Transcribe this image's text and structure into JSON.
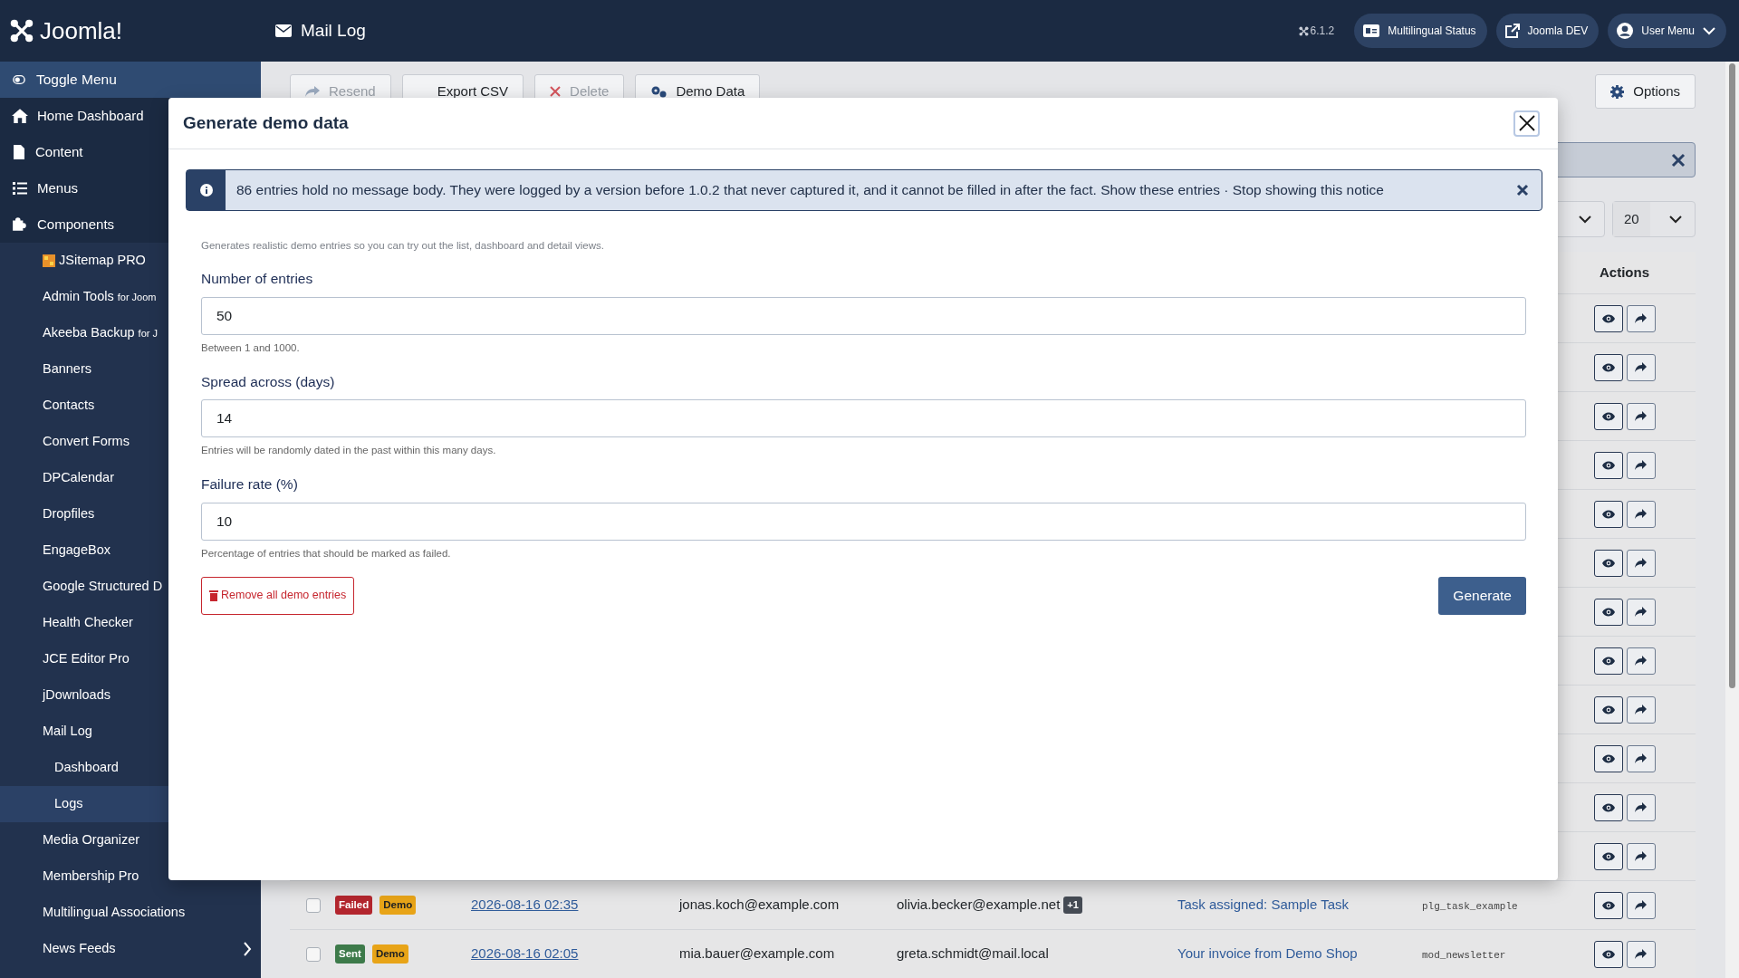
{
  "header": {
    "logo": "Joomla!",
    "title": "Mail Log",
    "version": "6.1.2",
    "buttons": [
      "Multilingual Status",
      "Joomla DEV",
      "User Menu"
    ]
  },
  "sidebar": {
    "toggle": "Toggle Menu",
    "items": [
      {
        "label": "Home Dashboard",
        "selected": false
      },
      {
        "label": "Content",
        "selected": false
      },
      {
        "label": "Menus",
        "selected": false
      },
      {
        "label": "Components",
        "selected": false,
        "children": [
          {
            "label": "JSitemap PRO",
            "selected": false
          },
          {
            "label": "Admin Tools",
            "suffix": "for Joom",
            "selected": false
          },
          {
            "label": "Akeeba Backup",
            "suffix": "for J",
            "selected": false
          },
          {
            "label": "Banners",
            "selected": false
          },
          {
            "label": "Contacts",
            "selected": false
          },
          {
            "label": "Convert Forms",
            "selected": false
          },
          {
            "label": "DPCalendar",
            "selected": false
          },
          {
            "label": "Dropfiles",
            "selected": false
          },
          {
            "label": "EngageBox",
            "selected": false
          },
          {
            "label": "Google Structured D",
            "selected": false
          },
          {
            "label": "Health Checker",
            "selected": false
          },
          {
            "label": "JCE Editor Pro",
            "selected": false
          },
          {
            "label": "jDownloads",
            "selected": false
          },
          {
            "label": "Mail Log",
            "selected": false,
            "children": [
              {
                "label": "Dashboard",
                "selected": false
              },
              {
                "label": "Logs",
                "selected": true
              }
            ]
          },
          {
            "label": "Media Organizer",
            "selected": false
          },
          {
            "label": "Membership Pro",
            "selected": false
          },
          {
            "label": "Multilingual Associations",
            "selected": false
          },
          {
            "label": "News Feeds",
            "selected": false,
            "expanded": false
          }
        ]
      }
    ]
  },
  "toolbar": {
    "buttons": [
      {
        "label": "Resend",
        "disabled": true
      },
      {
        "label": "Export CSV",
        "disabled": false
      },
      {
        "label": "Delete",
        "disabled": true
      },
      {
        "label": "Demo Data",
        "disabled": false
      }
    ],
    "options": "Options"
  },
  "filters": {
    "limit": "20"
  },
  "table": {
    "columns": [
      "Actions"
    ],
    "rows": [
      {
        "kind": "covered"
      },
      {
        "kind": "covered"
      },
      {
        "kind": "covered"
      },
      {
        "kind": "covered"
      },
      {
        "kind": "covered"
      },
      {
        "kind": "covered"
      },
      {
        "kind": "covered"
      },
      {
        "kind": "covered"
      },
      {
        "kind": "covered"
      },
      {
        "kind": "covered"
      },
      {
        "kind": "covered"
      },
      {
        "kind": "covered"
      },
      {
        "kind": "full",
        "checked": false,
        "status": "Failed",
        "color": "#b3262e",
        "tag": "Demo",
        "date": "2026-08-16 02:35",
        "from": "jonas.koch@example.com",
        "to": "olivia.becker@example.net",
        "extra": "+1",
        "subject": "Task assigned: Sample Task",
        "source": "plg_task_example"
      },
      {
        "kind": "full",
        "checked": false,
        "status": "Sent",
        "color": "#3d7a4a",
        "tag": "Demo",
        "date": "2026-08-16 02:05",
        "from": "mia.bauer@example.com",
        "to": "greta.schmidt@mail.local",
        "subject": "Your invoice from Demo Shop",
        "source": "mod_newsletter"
      }
    ]
  },
  "modal": {
    "title": "Generate demo data",
    "notice": {
      "text": "86 entries hold no message body. They were logged by a version before 1.0.2 that never captured it, and it cannot be filled in after the fact.",
      "links": [
        "Show these entries",
        "Stop showing this notice"
      ],
      "separator": "·"
    },
    "intro": "Generates realistic demo entries so you can try out the list, dashboard and detail views.",
    "fields": [
      {
        "label": "Number of entries",
        "value": "50",
        "help": "Between 1 and 1000."
      },
      {
        "label": "Spread across (days)",
        "value": "14",
        "help": "Entries will be randomly dated in the past within this many days."
      },
      {
        "label": "Failure rate (%)",
        "value": "10",
        "help": "Percentage of entries that should be marked as failed."
      }
    ],
    "remove_button": "Remove all demo entries",
    "generate_button": "Generate"
  }
}
